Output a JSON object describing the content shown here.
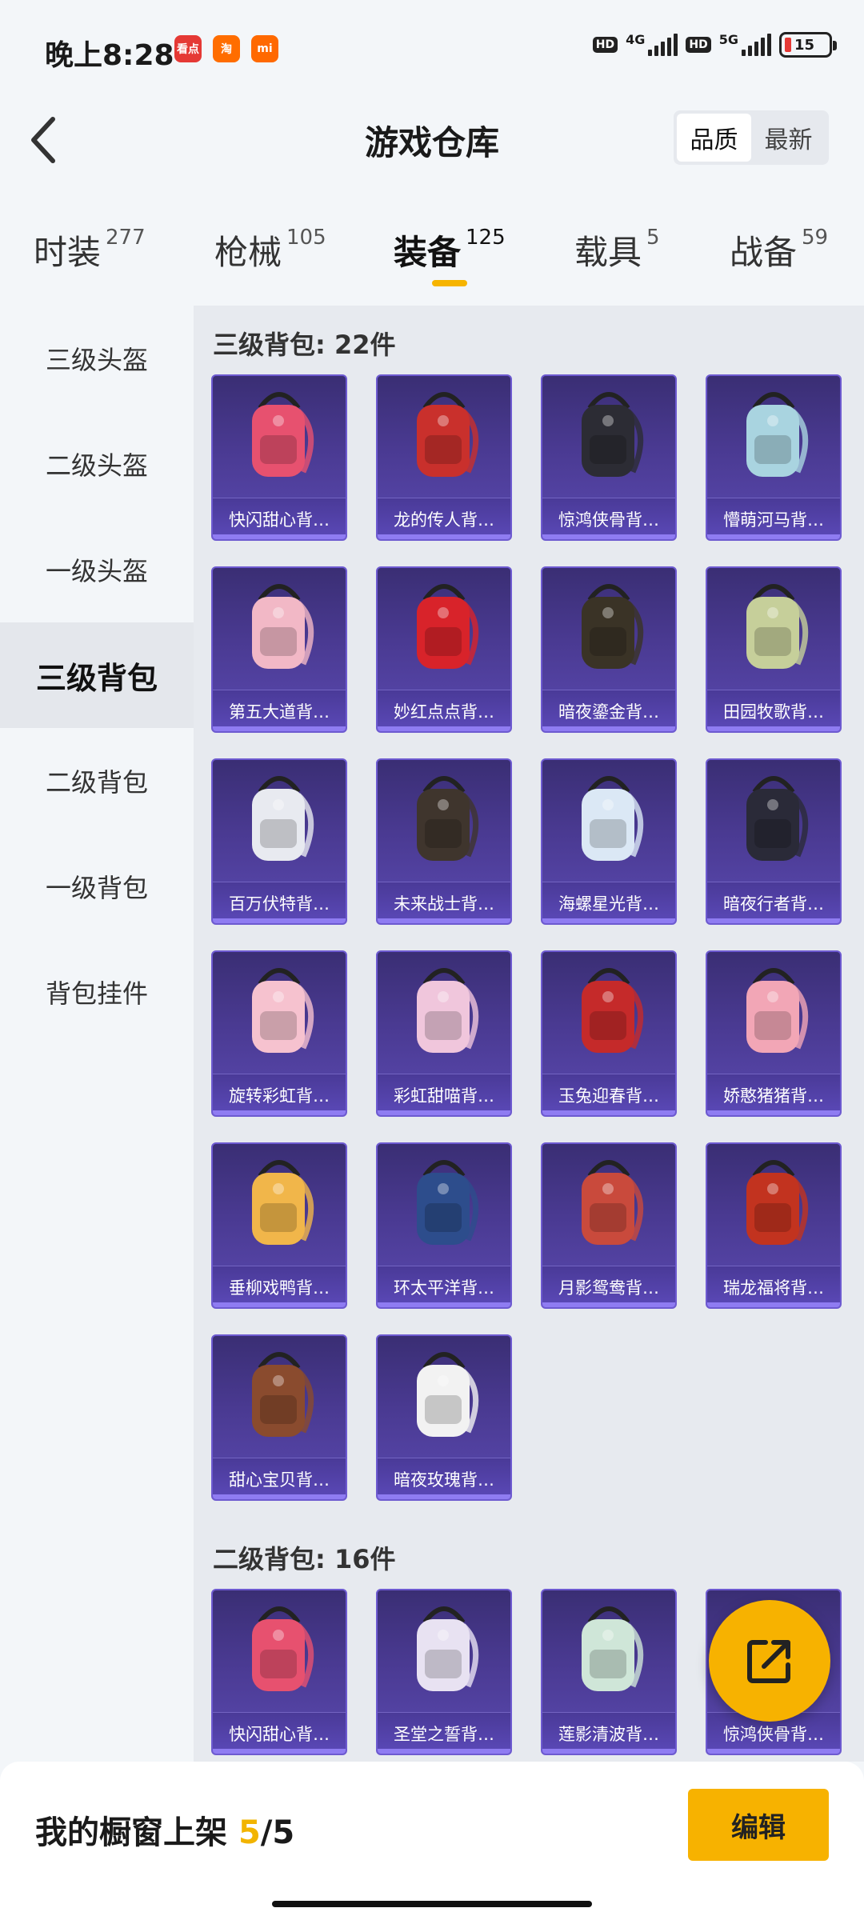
{
  "status_bar": {
    "time": "晚上8:28",
    "apps": [
      {
        "icon": "news-app-icon",
        "text": "看点",
        "color": "#e53935"
      },
      {
        "icon": "shopping-app-icon",
        "text": "淘",
        "color": "#ff6d00"
      },
      {
        "icon": "mi-app-icon",
        "text": "mi",
        "color": "#ff6900"
      }
    ],
    "hd1": "HD",
    "net1": "4G",
    "hd2": "HD",
    "net2": "5G",
    "battery": "15"
  },
  "header": {
    "title": "游戏仓库",
    "sort_quality": "品质",
    "sort_newest": "最新"
  },
  "tabs": [
    {
      "label": "时装",
      "count": "277"
    },
    {
      "label": "枪械",
      "count": "105"
    },
    {
      "label": "装备",
      "count": "125"
    },
    {
      "label": "载具",
      "count": "5"
    },
    {
      "label": "战备",
      "count": "59"
    }
  ],
  "active_tab": "装备",
  "left_nav": [
    "三级头盔",
    "二级头盔",
    "一级头盔",
    "三级背包",
    "二级背包",
    "一级背包",
    "背包挂件"
  ],
  "active_nav": "三级背包",
  "sections": [
    {
      "title": "三级背包: 22件",
      "items": [
        {
          "name": "快闪甜心背…",
          "color": "#e7516f"
        },
        {
          "name": "龙的传人背…",
          "color": "#c9302c"
        },
        {
          "name": "惊鸿侠骨背…",
          "color": "#2c2c34"
        },
        {
          "name": "懵萌河马背…",
          "color": "#a9d4e0"
        },
        {
          "name": "第五大道背…",
          "color": "#f2b8c6"
        },
        {
          "name": "妙红点点背…",
          "color": "#d8232a"
        },
        {
          "name": "暗夜鎏金背…",
          "color": "#3a3326"
        },
        {
          "name": "田园牧歌背…",
          "color": "#c6cf9a"
        },
        {
          "name": "百万伏特背…",
          "color": "#e8eaf0"
        },
        {
          "name": "未来战士背…",
          "color": "#3f352d"
        },
        {
          "name": "海螺星光背…",
          "color": "#dbe8f5"
        },
        {
          "name": "暗夜行者背…",
          "color": "#2a2a38"
        },
        {
          "name": "旋转彩虹背…",
          "color": "#f6c2cf"
        },
        {
          "name": "彩虹甜喵背…",
          "color": "#f0c6dc"
        },
        {
          "name": "玉兔迎春背…",
          "color": "#c52a2a"
        },
        {
          "name": "娇憨猪猪背…",
          "color": "#f2a6b6"
        },
        {
          "name": "垂柳戏鸭背…",
          "color": "#f1b64a"
        },
        {
          "name": "环太平洋背…",
          "color": "#2d4d8c"
        },
        {
          "name": "月影鸳鸯背…",
          "color": "#c94a3c"
        },
        {
          "name": "瑞龙福将背…",
          "color": "#c2331f"
        },
        {
          "name": "甜心宝贝背…",
          "color": "#8a4b2e"
        },
        {
          "name": "暗夜玫瑰背…",
          "color": "#f2f2f2"
        }
      ]
    },
    {
      "title": "二级背包: 16件",
      "items": [
        {
          "name": "快闪甜心背…",
          "color": "#e7516f"
        },
        {
          "name": "圣堂之誓背…",
          "color": "#e8e2f2"
        },
        {
          "name": "莲影清波背…",
          "color": "#cfe6d8"
        },
        {
          "name": "惊鸿侠骨背…",
          "color": "#2c2c34"
        }
      ]
    }
  ],
  "bottom_bar": {
    "shelf_label": "我的橱窗上架",
    "shelf_current": "5",
    "shelf_total": "/5",
    "edit_label": "编辑"
  }
}
